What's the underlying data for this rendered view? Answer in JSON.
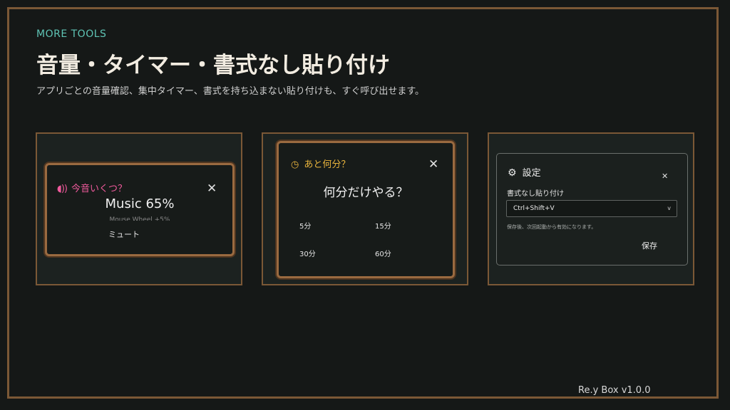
{
  "header": {
    "eyebrow": "MORE TOOLS",
    "title": "音量・タイマー・書式なし貼り付け",
    "subtitle": "アプリごとの音量確認、集中タイマー、書式を持ち込まない貼り付けも、すぐ呼び出せます。"
  },
  "mixer": {
    "icon": "speaker-icon",
    "heading": "今音いくつ？",
    "now_playing": "Music  65%",
    "hint": "Mouse Wheel  +5%",
    "mute_label": "ミュート",
    "close": "✕"
  },
  "timer": {
    "icon": "clock-icon",
    "heading": "あと何分？",
    "question": "何分だけやる？",
    "options": [
      "5分",
      "15分",
      "30分",
      "60分"
    ],
    "close": "✕"
  },
  "settings": {
    "icon": "gear-icon",
    "heading": "設定",
    "field_label": "書式なし貼り付け",
    "shortcut_value": "Ctrl+Shift+V",
    "chevron": "v",
    "hint": "保存後、次回起動から有効になります。",
    "save_label": "保存",
    "close": "✕"
  },
  "footer": {
    "version": "Re.y Box  v1.0.0"
  },
  "colors": {
    "border": "#7b5836",
    "accent_teal": "#5fc4b5",
    "accent_pink": "#f05a9c",
    "accent_amber": "#e9b43d",
    "background": "#151817"
  }
}
